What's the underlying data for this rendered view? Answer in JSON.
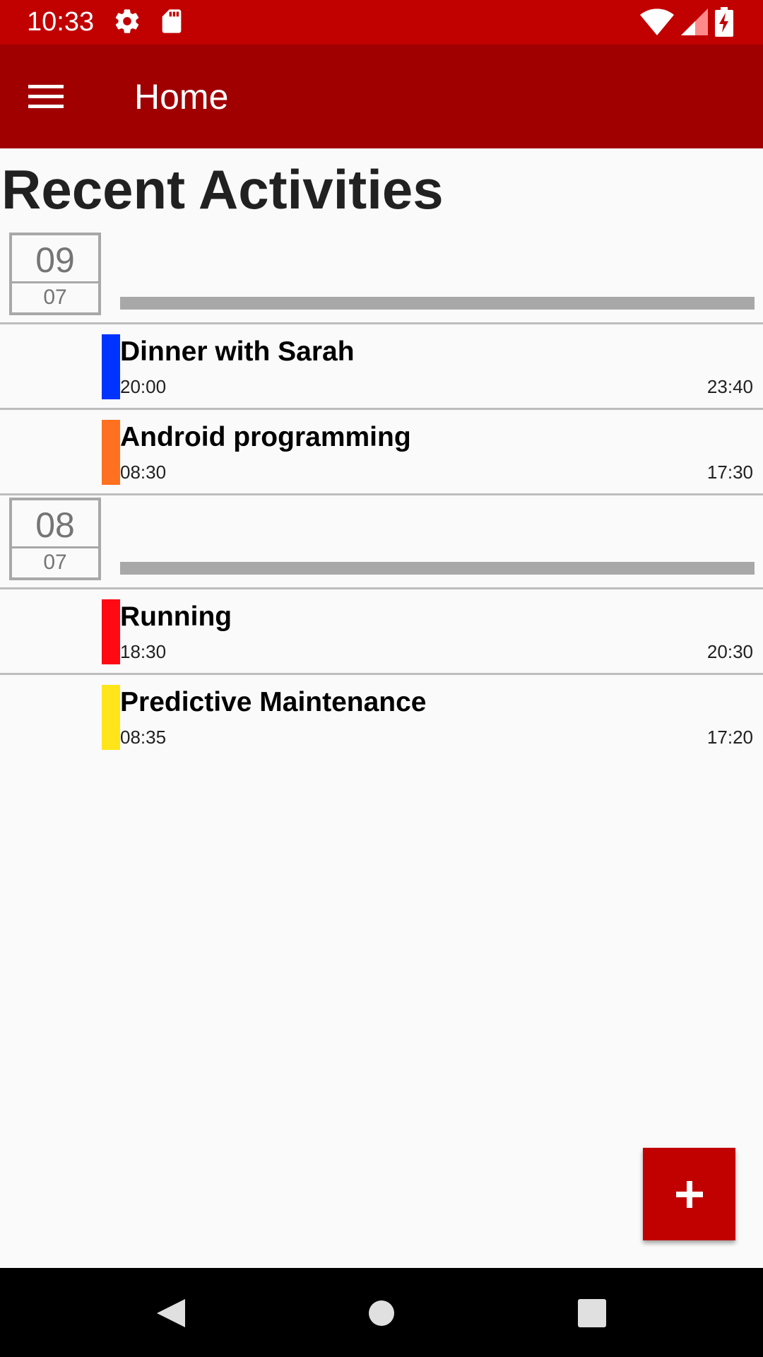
{
  "status_bar": {
    "time": "10:33",
    "icons": [
      "gear-icon",
      "sd-card-icon",
      "wifi-icon",
      "cell-signal-icon",
      "battery-charging-icon"
    ]
  },
  "app_bar": {
    "menu_icon": "hamburger-menu-icon",
    "title": "Home",
    "background": "#a00000"
  },
  "section_title": "Recent Activities",
  "groups": [
    {
      "day": "09",
      "month": "07",
      "activities": [
        {
          "name": "Dinner with Sarah",
          "start": "20:00",
          "end": "23:40",
          "color": "#0033ff"
        },
        {
          "name": "Android programming",
          "start": "08:30",
          "end": "17:30",
          "color": "#ff7020"
        }
      ]
    },
    {
      "day": "08",
      "month": "07",
      "activities": [
        {
          "name": "Running",
          "start": "18:30",
          "end": "20:30",
          "color": "#ff0a14"
        },
        {
          "name": "Predictive Maintenance",
          "start": "08:35",
          "end": "17:20",
          "color": "#ffe51a"
        }
      ]
    }
  ],
  "fab": {
    "icon": "plus-icon",
    "color": "#c10000"
  },
  "nav_bar": {
    "icons": [
      "back-icon",
      "home-icon",
      "recents-icon"
    ]
  }
}
